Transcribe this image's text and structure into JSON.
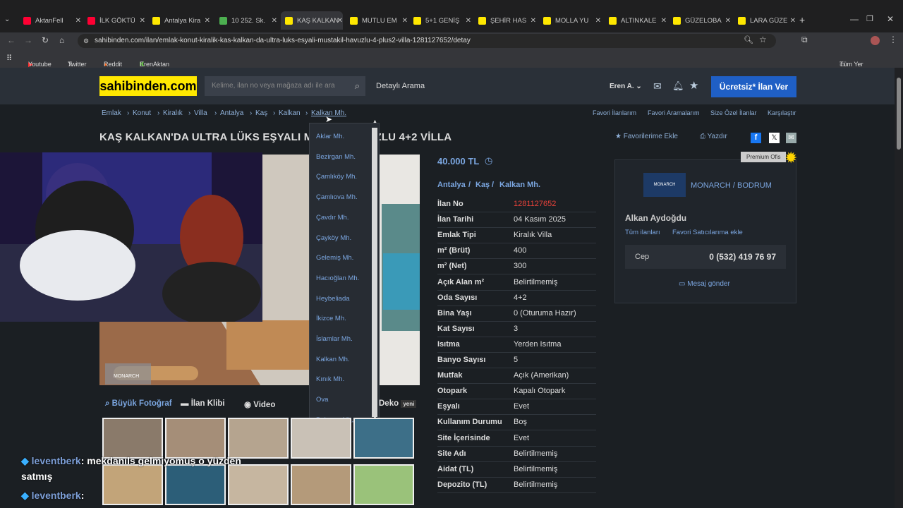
{
  "tabs": [
    {
      "label": "AktanFell",
      "icon": "youtube-icon",
      "color": "#ff0033"
    },
    {
      "label": "İLK GÖKTÜ",
      "icon": "youtube-icon",
      "color": "#ff0033"
    },
    {
      "label": "Antalya Kira",
      "icon": "sahibinden-icon",
      "color": "#ffe800"
    },
    {
      "label": "10 252. Sk.",
      "icon": "maps-icon",
      "color": "#4caf50"
    },
    {
      "label": "KAŞ KALKAN",
      "icon": "sahibinden-icon",
      "color": "#ffe800"
    },
    {
      "label": "MUTLU EM",
      "icon": "sahibinden-icon",
      "color": "#ffe800"
    },
    {
      "label": "5+1 GENİŞ",
      "icon": "sahibinden-icon",
      "color": "#ffe800"
    },
    {
      "label": "ŞEHİR HAS",
      "icon": "sahibinden-icon",
      "color": "#ffe800"
    },
    {
      "label": "MOLLA YU",
      "icon": "sahibinden-icon",
      "color": "#ffe800"
    },
    {
      "label": "ALTINKALE",
      "icon": "sahibinden-icon",
      "color": "#ffe800"
    },
    {
      "label": "GÜZELOBA",
      "icon": "sahibinden-icon",
      "color": "#ffe800"
    },
    {
      "label": "LARA GÜZE",
      "icon": "sahibinden-icon",
      "color": "#ffe800"
    }
  ],
  "url": "sahibinden.com/ilan/emlak-konut-kiralik-kas-kalkan-da-ultra-luks-esyali-mustakil-havuzlu-4-plus2-villa-1281127652/detay",
  "bookmarks": [
    "Youtube",
    "Twitter",
    "Reddit",
    "ErenAktan | Kick"
  ],
  "bookmarks_right": "Tüm Yer İşaretleri",
  "header": {
    "logo": "sahibinden.com",
    "search_placeholder": "Kelime, ilan no veya mağaza adı ile ara",
    "detailed": "Detaylı Arama",
    "user": "Eren A.",
    "post_button": "Ücretsiz* İlan Ver"
  },
  "breadcrumb": [
    "Emlak",
    "Konut",
    "Kiralık",
    "Villa",
    "Antalya",
    "Kaş",
    "Kalkan",
    "Kalkan Mh."
  ],
  "top_links": [
    "Favori İlanlarım",
    "Favori Aramalarım",
    "Size Özel İlanlar",
    "Karşılaştır"
  ],
  "title": "KAŞ KALKAN'DA ULTRA LÜKS EŞYALI MÜ",
  "title_tail": "UZLU 4+2 VİLLA",
  "actions": {
    "fav": "Favorilerime Ekle",
    "print": "Yazdır"
  },
  "dropdown": [
    "Aklar Mh.",
    "Bezirgan Mh.",
    "Çamlıköy Mh.",
    "Çamlıova Mh.",
    "Çavdır Mh.",
    "Çayköy Mh.",
    "Gelemiş Mh.",
    "Hacıoğlan Mh.",
    "Heybeliada",
    "İkizce Mh.",
    "İslamlar Mh.",
    "Kalkan Mh.",
    "Kınık Mh.",
    "Ova",
    "Palamut Mh."
  ],
  "price": "40.000 TL",
  "location": [
    "Antalya",
    "Kaş",
    "Kalkan Mh."
  ],
  "details": [
    [
      "İlan No",
      "1281127652"
    ],
    [
      "İlan Tarihi",
      "04 Kasım 2025"
    ],
    [
      "Emlak Tipi",
      "Kiralık Villa"
    ],
    [
      "m² (Brüt)",
      "400"
    ],
    [
      "m² (Net)",
      "300"
    ],
    [
      "Açık Alan m²",
      "Belirtilmemiş"
    ],
    [
      "Oda Sayısı",
      "4+2"
    ],
    [
      "Bina Yaşı",
      "0 (Oturuma Hazır)"
    ],
    [
      "Kat Sayısı",
      "3"
    ],
    [
      "Isıtma",
      "Yerden Isıtma"
    ],
    [
      "Banyo Sayısı",
      "5"
    ],
    [
      "Mutfak",
      "Açık (Amerikan)"
    ],
    [
      "Otopark",
      "Kapalı Otopark"
    ],
    [
      "Eşyalı",
      "Evet"
    ],
    [
      "Kullanım Durumu",
      "Boş"
    ],
    [
      "Site İçerisinde",
      "Evet"
    ],
    [
      "Site Adı",
      "Belirtilmemiş"
    ],
    [
      "Aidat (TL)",
      "Belirtilmemiş"
    ],
    [
      "Depozito (TL)",
      "Belirtilmemiş"
    ]
  ],
  "media_tabs": [
    "Büyük Fotoğraf",
    "İlan Klibi",
    "Video",
    "Deko",
    "yeni"
  ],
  "seller": {
    "badge": "Premium Ofis",
    "office": "MONARCH / BODRUM",
    "logo_text": "MONARCH",
    "name": "Alkan Aydoğdu",
    "all": "Tüm ilanları",
    "fav": "Favori Satıcılarıma ekle",
    "phone_label": "Cep",
    "phone": "0 (532) 419 76 97",
    "message": "Mesaj gönder"
  },
  "photo_watermark": "MONARCH",
  "chat": [
    {
      "user": "leventberk",
      "msg": ": mekdanıls gelmiyomuş o yüzden"
    },
    {
      "user": "",
      "msg": "satmış"
    },
    {
      "user": "leventberk",
      "msg": ":"
    }
  ]
}
